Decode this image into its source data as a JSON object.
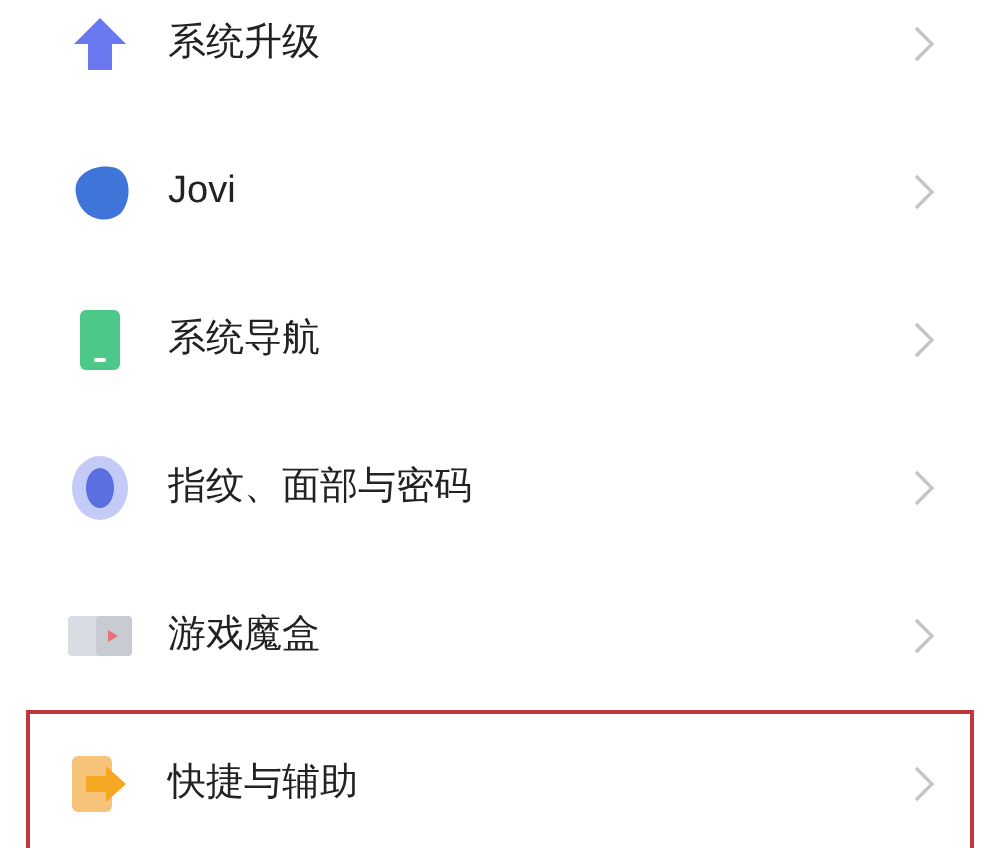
{
  "settings_items": [
    {
      "label": "系统升级",
      "highlighted": false
    },
    {
      "label": "Jovi",
      "highlighted": false
    },
    {
      "label": "系统导航",
      "highlighted": false
    },
    {
      "label": "指纹、面部与密码",
      "highlighted": false
    },
    {
      "label": "游戏魔盒",
      "highlighted": false
    },
    {
      "label": "快捷与辅助",
      "highlighted": true
    }
  ]
}
